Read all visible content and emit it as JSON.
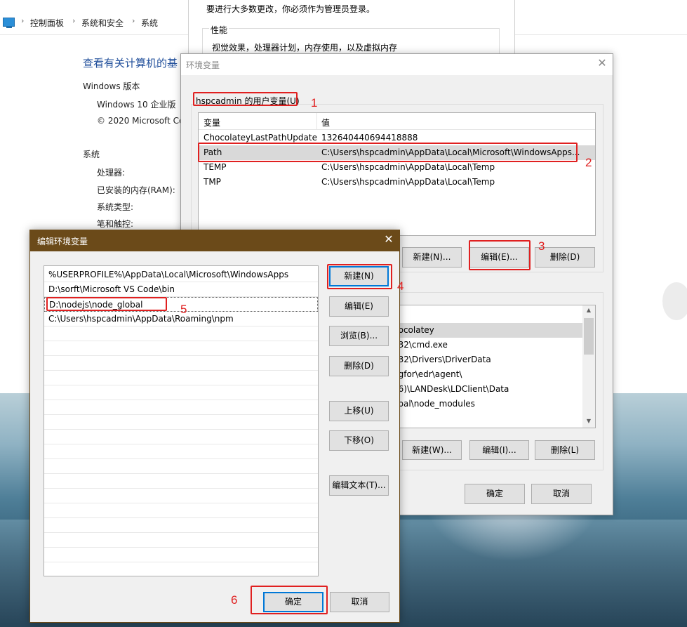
{
  "control_panel": {
    "breadcrumb": [
      "控制面板",
      "系统和安全",
      "系统"
    ],
    "separator": "›",
    "title": "查看有关计算机的基",
    "windows_edition_label": "Windows 版本",
    "edition": "Windows 10 企业版",
    "copyright": "© 2020 Microsoft Co",
    "system_label": "系统",
    "processor_label": "处理器:",
    "ram_label": "已安装的内存(RAM):",
    "system_type_label": "系统类型:",
    "pen_touch_label": "笔和触控:"
  },
  "admin_window": {
    "notice": "要进行大多数更改，你必须作为管理员登录。",
    "performance_label": "性能",
    "performance_text": "视觉效果，处理器计划，内存使用，以及虚拟内存"
  },
  "env_dialog": {
    "title": "环境变量",
    "close": "✕",
    "user_vars_label": "hspcadmin 的用户变量(U)",
    "columns": [
      "变量",
      "值"
    ],
    "user_vars": [
      {
        "name": "ChocolateyLastPathUpdate",
        "value": "132640440694418888"
      },
      {
        "name": "Path",
        "value": "C:\\Users\\hspcadmin\\AppData\\Local\\Microsoft\\WindowsApps..."
      },
      {
        "name": "TEMP",
        "value": "C:\\Users\\hspcadmin\\AppData\\Local\\Temp"
      },
      {
        "name": "TMP",
        "value": "C:\\Users\\hspcadmin\\AppData\\Local\\Temp"
      }
    ],
    "user_buttons": {
      "new": "新建(N)...",
      "edit": "编辑(E)...",
      "delete": "删除(D)"
    },
    "system_vars_partial": [
      "hocolatey",
      "n32\\cmd.exe",
      "n32\\Drivers\\DriverData",
      "ngfor\\edr\\agent\\",
      "86)\\LANDesk\\LDClient\\Data",
      "obal\\node_modules"
    ],
    "system_buttons": {
      "new": "新建(W)...",
      "edit": "编辑(I)...",
      "delete": "删除(L)"
    },
    "ok": "确定",
    "cancel": "取消"
  },
  "edit_dialog": {
    "title": "编辑环境变量",
    "close": "✕",
    "entries": [
      "%USERPROFILE%\\AppData\\Local\\Microsoft\\WindowsApps",
      "D:\\sorft\\Microsoft VS Code\\bin",
      "D:\\nodejs\\node_global",
      "C:\\Users\\hspcadmin\\AppData\\Roaming\\npm"
    ],
    "buttons": {
      "new": "新建(N)",
      "edit": "编辑(E)",
      "browse": "浏览(B)...",
      "delete": "删除(D)",
      "move_up": "上移(U)",
      "move_down": "下移(O)",
      "edit_text": "编辑文本(T)..."
    },
    "ok": "确定",
    "cancel": "取消"
  },
  "annotations": [
    "1",
    "2",
    "3",
    "4",
    "5",
    "6"
  ],
  "colors": {
    "annotation": "#e02020",
    "edit_titlebar": "#6b4a19",
    "link_title": "#1e4d9a",
    "focus_blue": "#0078d7"
  }
}
